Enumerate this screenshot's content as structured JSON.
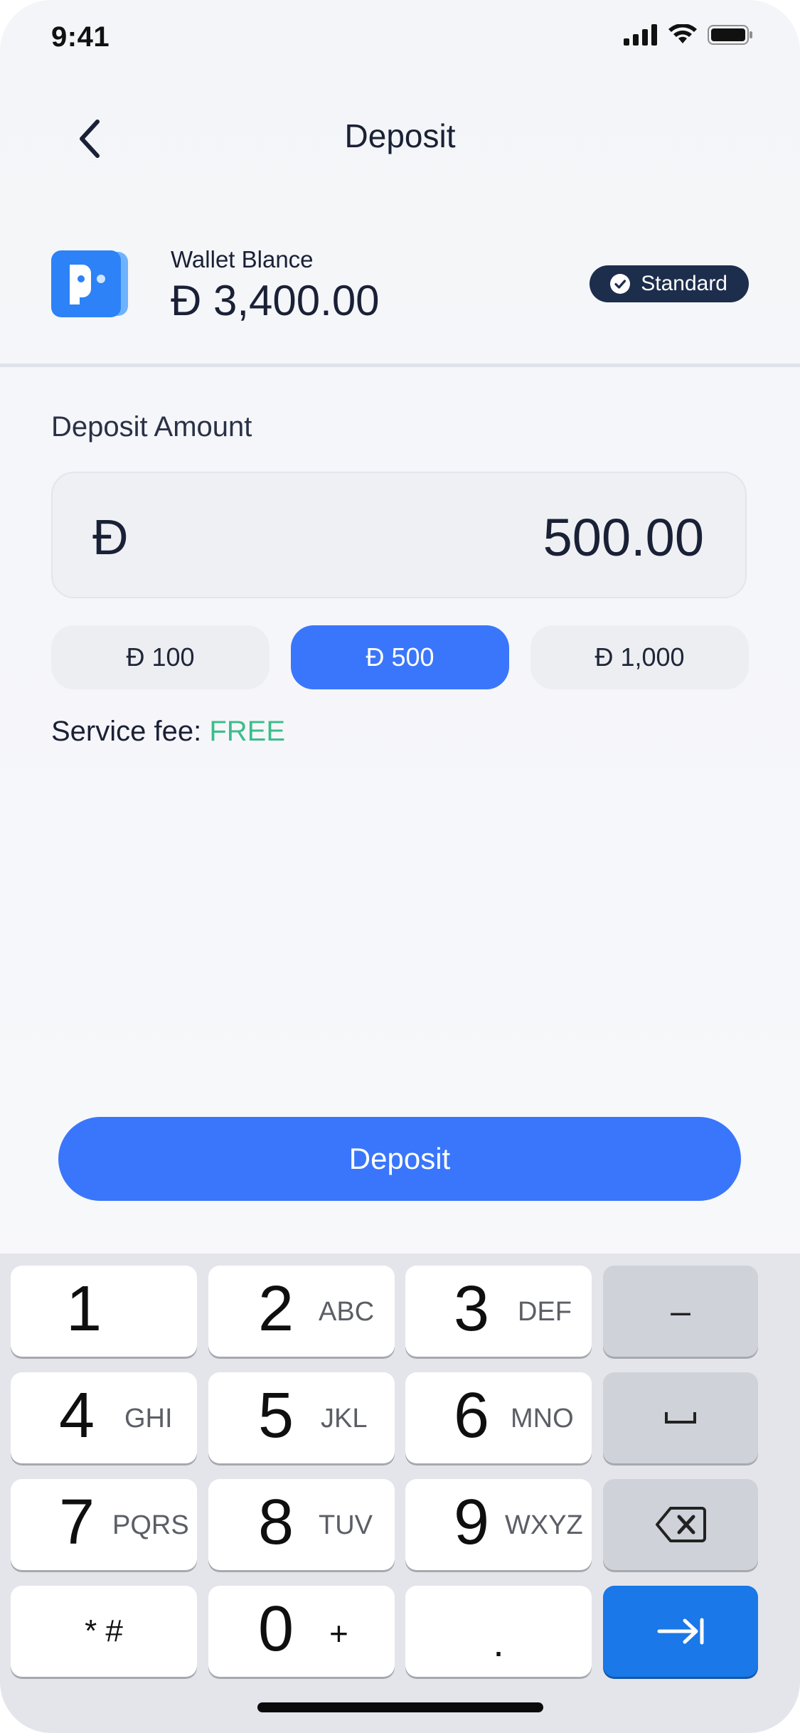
{
  "status_bar": {
    "time": "9:41"
  },
  "header": {
    "title": "Deposit"
  },
  "wallet": {
    "label": "Wallet Blance",
    "currency_symbol": "Đ",
    "balance": "Đ 3,400.00",
    "badge": "Standard"
  },
  "deposit": {
    "label": "Deposit Amount",
    "currency_symbol": "Đ",
    "amount": "500.00",
    "presets": [
      {
        "label": "Đ 100",
        "selected": false
      },
      {
        "label": "Đ 500",
        "selected": true
      },
      {
        "label": "Đ 1,000",
        "selected": false
      }
    ],
    "fee_label": "Service fee: ",
    "fee_value": "FREE"
  },
  "submit_button": {
    "label": "Deposit"
  },
  "keyboard": {
    "keys": [
      {
        "num": "1",
        "letters": ""
      },
      {
        "num": "2",
        "letters": "ABC"
      },
      {
        "num": "3",
        "letters": "DEF"
      },
      {
        "num": "4",
        "letters": "GHI"
      },
      {
        "num": "5",
        "letters": "JKL"
      },
      {
        "num": "6",
        "letters": "MNO"
      },
      {
        "num": "7",
        "letters": "PQRS"
      },
      {
        "num": "8",
        "letters": "TUV"
      },
      {
        "num": "9",
        "letters": "WXYZ"
      },
      {
        "num": "0",
        "letters": "+"
      }
    ],
    "symbols_key": "* #",
    "dot_key": ".",
    "minus_key": "–"
  },
  "colors": {
    "accent": "#3a76fb",
    "fee_free": "#3cbd8b",
    "badge_bg": "#1d2d4c",
    "text_primary": "#1a2136",
    "keyboard_action": "#1a78e8"
  }
}
